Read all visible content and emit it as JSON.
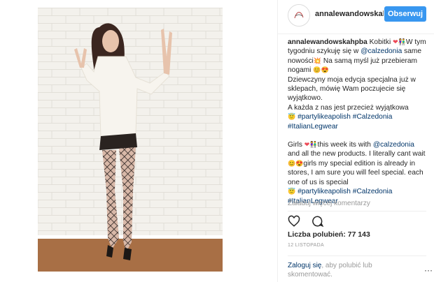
{
  "header": {
    "username": "annalewandowskah",
    "follow_label": "Obserwuj"
  },
  "caption": {
    "username": "annalewandowskahpba",
    "pl_1": "Kobitki",
    "pl_2": "W tym tygodniu szykuję się w",
    "pl_mention": "@calzedonia",
    "pl_3": "same nowości",
    "pl_4": "Na samą myśl już przebieram nogami",
    "pl_5": "Dziewczyny moja edycja specjalna już w sklepach, mówię Wam poczujecie się wyjątkowo.",
    "pl_6": "A każda z nas jest przecież wyjątkowa",
    "hashtags_1": "#partylikeapolish #Calzedonia #ItalianLegwear",
    "en_1": "Girls",
    "en_2": "this week its with",
    "en_mention": "@calzedonia",
    "en_3": "and all the new products. I literally cant wait",
    "en_4": "girls my special edition is already in stores, I am sure you will feel special. each one of us is special",
    "hashtags_2": "#partylikeapolish #Calzedonia #ItalianLegwear"
  },
  "more_comments": "Załaduj więcej komentarzy",
  "likes": "Liczba polubień: 77 143",
  "date": "12 LISTOPADA",
  "login": {
    "link": "Zaloguj się",
    "text": ", aby polubić lub skomentować."
  },
  "more_dots": "···",
  "icons": {
    "like": "heart-icon",
    "comment": "comment-icon",
    "more": "more-options-icon"
  },
  "colors": {
    "follow_button": "#3897f0",
    "link": "#003569",
    "heart": "#ed4956",
    "muted": "#999999"
  }
}
